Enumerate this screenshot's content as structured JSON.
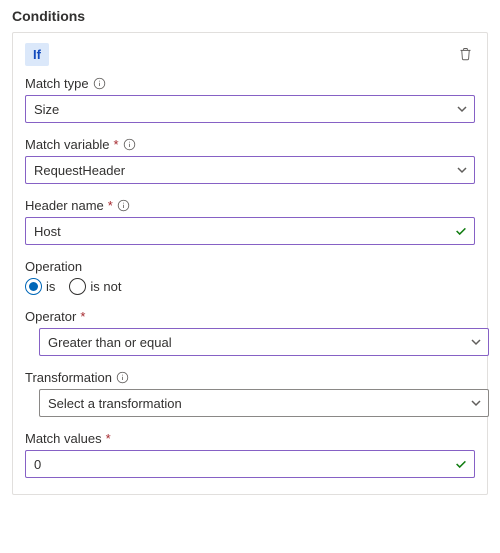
{
  "section_title": "Conditions",
  "chip": "If",
  "match_type": {
    "label": "Match type",
    "value": "Size"
  },
  "match_variable": {
    "label": "Match variable",
    "value": "RequestHeader"
  },
  "header_name": {
    "label": "Header name",
    "value": "Host"
  },
  "operation": {
    "label": "Operation",
    "is_label": "is",
    "isnot_label": "is not",
    "selected": "is"
  },
  "operator": {
    "label": "Operator",
    "value": "Greater than or equal"
  },
  "transformation": {
    "label": "Transformation",
    "placeholder": "Select a transformation"
  },
  "match_values": {
    "label": "Match values",
    "value": "0"
  }
}
